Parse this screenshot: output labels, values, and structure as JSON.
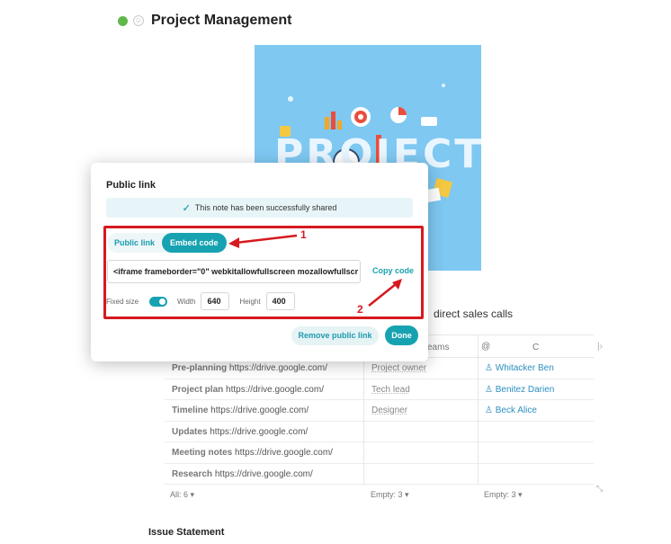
{
  "page": {
    "title": "Project Management",
    "hero_word": "PROJECT",
    "bg_text": "direct sales calls",
    "issue_heading": "Issue Statement"
  },
  "table": {
    "headers": {
      "teams": "eams",
      "at": "@",
      "c": "C",
      "edge": "|›"
    },
    "rows": [
      {
        "name": "Pre-planning",
        "url": "https://drive.google.com/",
        "role": "Project owner",
        "person": "Whitacker Ben"
      },
      {
        "name": "Project plan",
        "url": "https://drive.google.com/",
        "role": "Tech lead",
        "person": "Benitez Darien"
      },
      {
        "name": "Timeline",
        "url": "https://drive.google.com/",
        "role": "Designer",
        "person": "Beck Alice"
      },
      {
        "name": "Updates",
        "url": "https://drive.google.com/",
        "role": "",
        "person": ""
      },
      {
        "name": "Meeting notes",
        "url": "https://drive.google.com/",
        "role": "",
        "person": ""
      },
      {
        "name": "Research",
        "url": "https://drive.google.com/",
        "role": "",
        "person": ""
      }
    ],
    "footer": {
      "all": "All: 6 ▾",
      "empty1": "Empty: 3 ▾",
      "empty2": "Empty: 3 ▾"
    }
  },
  "modal": {
    "title": "Public link",
    "success_message": "This note has been successfully shared",
    "tabs": {
      "public": "Public link",
      "embed": "Embed code"
    },
    "embed_code": "<iframe frameborder=\"0\" webkitallowfullscreen mozallowfullscr",
    "copy_label": "Copy code",
    "fixed_size_label": "Fixed size",
    "width_label": "Width",
    "width_value": "640",
    "height_label": "Height",
    "height_value": "400",
    "remove_label": "Remove public link",
    "done_label": "Done"
  },
  "annotations": {
    "one": "1",
    "two": "2"
  },
  "colors": {
    "accent": "#17a2b1",
    "annotation": "#d71920",
    "status_dot": "#5fb84a",
    "hero_bg": "#7ec8f2"
  },
  "icons": {
    "check": "check-icon",
    "smiley": "smiley-icon",
    "person": "person-icon"
  }
}
